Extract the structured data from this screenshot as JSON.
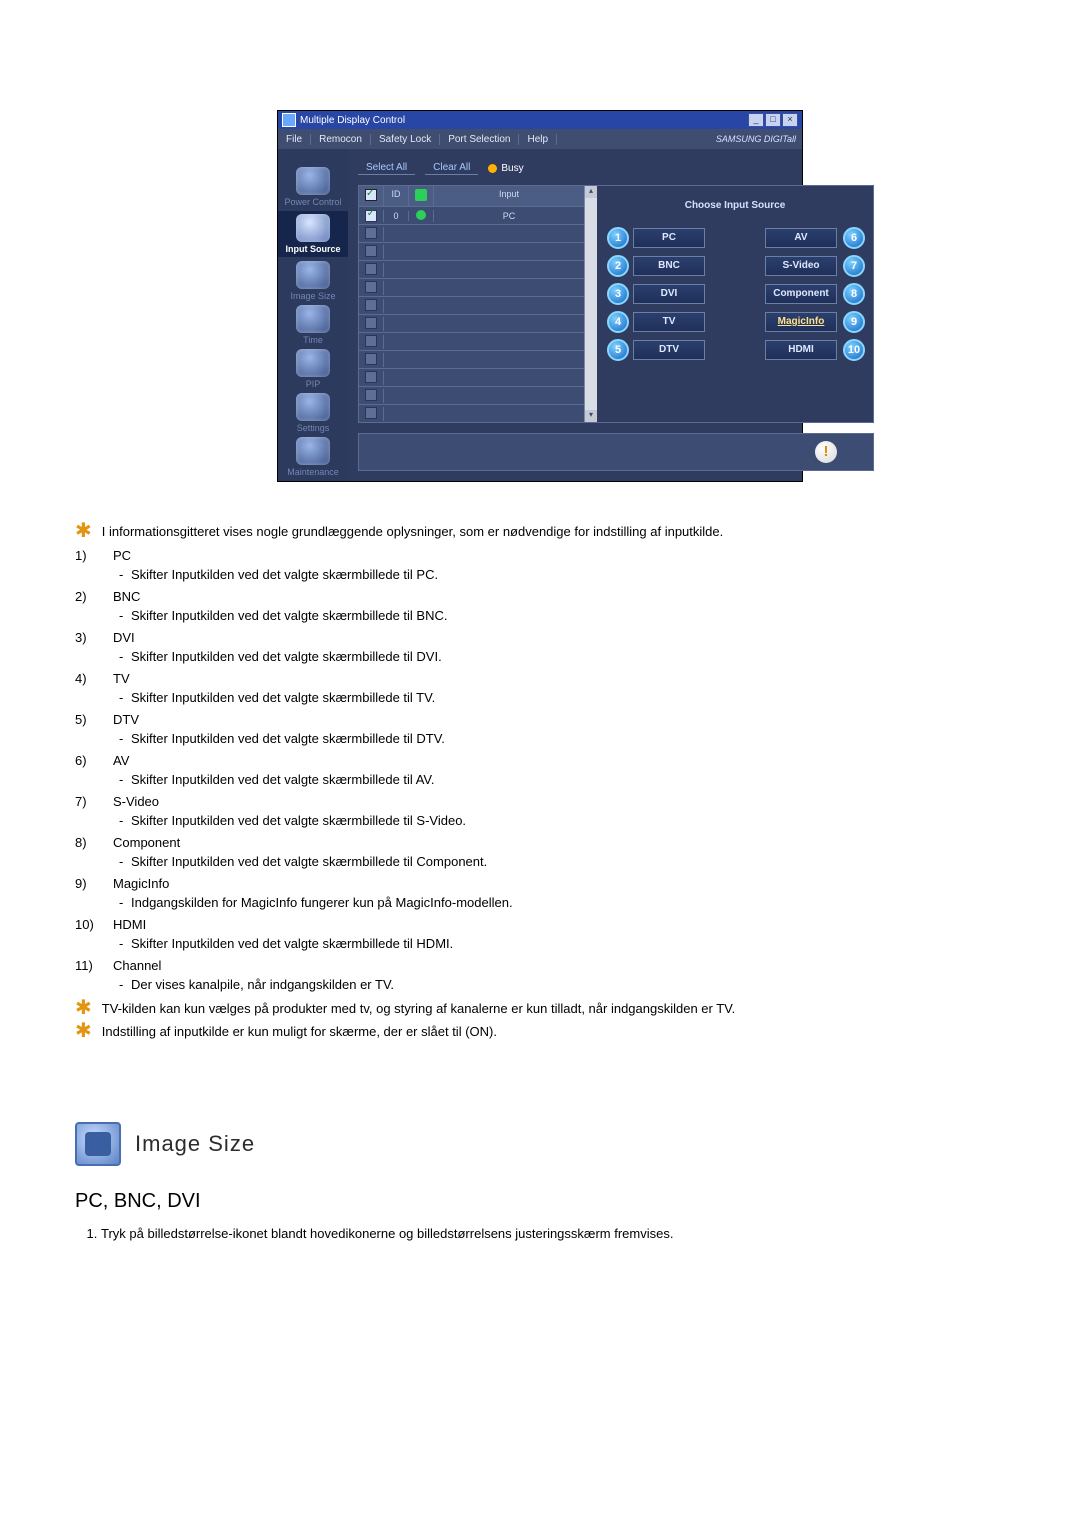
{
  "app": {
    "title": "Multiple Display Control",
    "windowControls": {
      "min": "_",
      "max": "□",
      "close": "×"
    },
    "menu": [
      "File",
      "Remocon",
      "Safety Lock",
      "Port Selection",
      "Help"
    ],
    "brand": "SAMSUNG DIGITall"
  },
  "sidebar": {
    "items": [
      {
        "label": "Power Control",
        "selected": false
      },
      {
        "label": "Input Source",
        "selected": true
      },
      {
        "label": "Image Size",
        "selected": false
      },
      {
        "label": "Time",
        "selected": false
      },
      {
        "label": "PIP",
        "selected": false
      },
      {
        "label": "Settings",
        "selected": false
      },
      {
        "label": "Maintenance",
        "selected": false
      }
    ]
  },
  "toolbar": {
    "selectAll": "Select All",
    "clearAll": "Clear All",
    "busy": "Busy"
  },
  "grid": {
    "headers": {
      "id": "ID",
      "input": "Input"
    },
    "firstRow": {
      "id": "0",
      "input": "PC"
    },
    "blankRows": 11
  },
  "panel": {
    "title": "Choose Input Source",
    "left": [
      {
        "n": "1",
        "label": "PC"
      },
      {
        "n": "2",
        "label": "BNC"
      },
      {
        "n": "3",
        "label": "DVI"
      },
      {
        "n": "4",
        "label": "TV"
      },
      {
        "n": "5",
        "label": "DTV"
      }
    ],
    "right": [
      {
        "n": "6",
        "label": "AV"
      },
      {
        "n": "7",
        "label": "S-Video"
      },
      {
        "n": "8",
        "label": "Component"
      },
      {
        "n": "9",
        "label": "MagicInfo",
        "magic": true
      },
      {
        "n": "10",
        "label": "HDMI"
      }
    ]
  },
  "info_icon": "!",
  "doc": {
    "intro_star": "I informationsgitteret vises nogle grundlæggende oplysninger, som er nødvendige for indstilling af inputkilde.",
    "items": [
      {
        "n": "1)",
        "title": "PC",
        "desc": "Skifter Inputkilden ved det valgte skærmbillede til PC."
      },
      {
        "n": "2)",
        "title": "BNC",
        "desc": "Skifter Inputkilden ved det valgte skærmbillede til BNC."
      },
      {
        "n": "3)",
        "title": "DVI",
        "desc": "Skifter Inputkilden ved det valgte skærmbillede til DVI."
      },
      {
        "n": "4)",
        "title": "TV",
        "desc": "Skifter Inputkilden ved det valgte skærmbillede til TV."
      },
      {
        "n": "5)",
        "title": "DTV",
        "desc": "Skifter Inputkilden ved det valgte skærmbillede til DTV."
      },
      {
        "n": "6)",
        "title": "AV",
        "desc": "Skifter Inputkilden ved det valgte skærmbillede til AV."
      },
      {
        "n": "7)",
        "title": "S-Video",
        "desc": "Skifter Inputkilden ved det valgte skærmbillede til S-Video."
      },
      {
        "n": "8)",
        "title": "Component",
        "desc": "Skifter Inputkilden ved det valgte skærmbillede til Component."
      },
      {
        "n": "9)",
        "title": "MagicInfo",
        "desc": "Indgangskilden for MagicInfo fungerer kun på MagicInfo-modellen."
      },
      {
        "n": "10)",
        "title": "HDMI",
        "desc": "Skifter Inputkilden ved det valgte skærmbillede til HDMI."
      },
      {
        "n": "11)",
        "title": "Channel",
        "desc": "Der vises kanalpile, når indgangskilden er TV."
      }
    ],
    "note1": "TV-kilden kan kun vælges på produkter med tv, og styring af kanalerne er kun tilladt, når indgangskilden er TV.",
    "note2": "Indstilling af inputkilde er kun muligt for skærme, der er slået til (ON).",
    "section_heading": "Image Size",
    "subheading": "PC, BNC, DVI",
    "step1": "Tryk på billedstørrelse-ikonet blandt hovedikonerne og billedstørrelsens justeringsskærm fremvises."
  }
}
